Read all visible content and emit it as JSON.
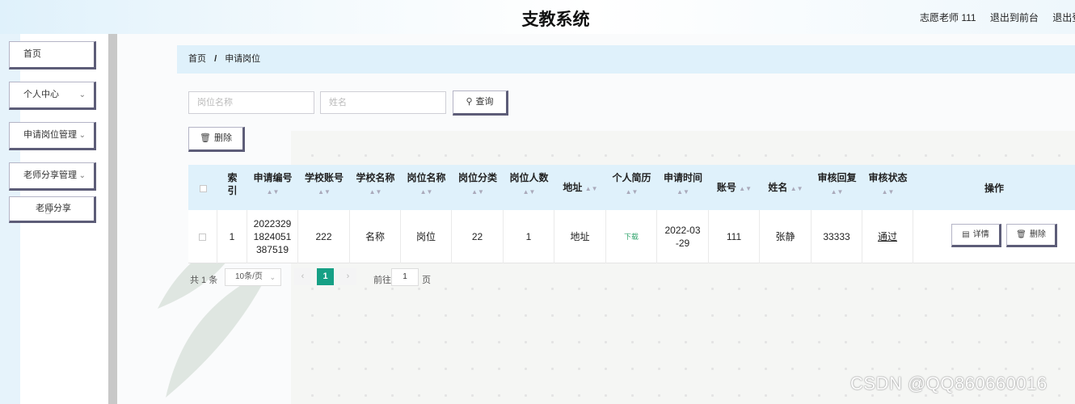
{
  "header": {
    "title": "支教系统",
    "user": "志愿老师 111",
    "back_front": "退出到前台",
    "logout": "退出登"
  },
  "sidebar": {
    "items": [
      {
        "label": "首页"
      },
      {
        "label": "个人中心"
      },
      {
        "label": "申请岗位管理"
      },
      {
        "label": "老师分享管理"
      },
      {
        "label": "老师分享"
      }
    ]
  },
  "breadcrumb": {
    "home": "首页",
    "separator": "/",
    "current": "申请岗位"
  },
  "search": {
    "post_placeholder": "岗位名称",
    "name_placeholder": "姓名",
    "query_label": "查询"
  },
  "toolbar": {
    "delete_label": "删除"
  },
  "table": {
    "headers": {
      "index": "索引",
      "apply_no": "申请编号",
      "school_account": "学校账号",
      "school_name": "学校名称",
      "post_name": "岗位名称",
      "post_category": "岗位分类",
      "post_count": "岗位人数",
      "address": "地址",
      "resume": "个人简历",
      "apply_time": "申请时间",
      "account": "账号",
      "name": "姓名",
      "review_reply": "审核回复",
      "review_status": "审核状态",
      "actions": "操作"
    },
    "rows": [
      {
        "index": "1",
        "apply_no": "20223291824051387519",
        "school_account": "222",
        "school_name": "名称",
        "post_name": "岗位",
        "post_category": "22",
        "post_count": "1",
        "address": "地址",
        "resume": "下载",
        "apply_time": "2022-03-29",
        "account": "111",
        "name": "张静",
        "review_reply": "33333",
        "review_status": "通过",
        "detail_label": "详情",
        "delete_label": "删除"
      }
    ]
  },
  "pagination": {
    "total": "共 1 条",
    "page_size": "10条/页",
    "current_page": "1",
    "goto_label": "前往",
    "goto_value": "1",
    "page_unit": "页"
  },
  "watermark": "CSDN @QQ860660016",
  "colors": {
    "accent": "#16a085",
    "header_bg": "#dff1fb",
    "button_shadow": "#5d5d78"
  }
}
